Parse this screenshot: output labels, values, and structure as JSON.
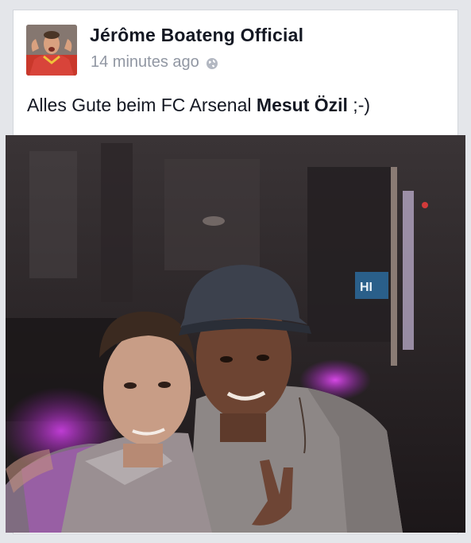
{
  "post": {
    "author": "Jérôme Boateng Official",
    "timestamp": "14 minutes ago",
    "privacy_icon": "globe-icon",
    "text_before": "Alles Gute beim FC Arsenal ",
    "mention": "Mesut Özil",
    "text_after": " ;-)"
  },
  "photo": {
    "sign_text": "HI"
  },
  "colors": {
    "background": "#e4e6ea",
    "card": "#ffffff",
    "author_text": "#141823",
    "meta_text": "#9197a3",
    "neon_accent": "#c23ad6"
  }
}
